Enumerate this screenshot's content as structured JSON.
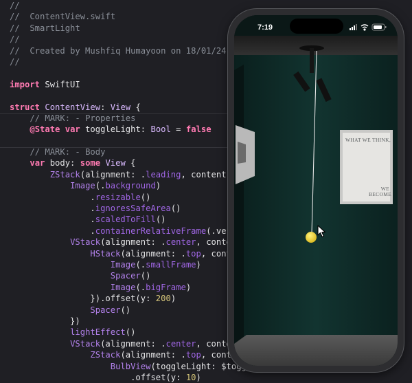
{
  "editor": {
    "lines": [
      [
        [
          "cm",
          "//"
        ]
      ],
      [
        [
          "cm",
          "//  ContentView.swift"
        ]
      ],
      [
        [
          "cm",
          "//  SmartLight"
        ]
      ],
      [
        [
          "cm",
          "//"
        ]
      ],
      [
        [
          "cm",
          "//  Created by Mushfiq Humayoon on 18/01/24."
        ]
      ],
      [
        [
          "cm",
          "//"
        ]
      ],
      [],
      [
        [
          "kw",
          "import"
        ],
        [
          "id",
          " SwiftUI"
        ]
      ],
      [],
      [
        [
          "kw",
          "struct"
        ],
        [
          "id",
          " "
        ],
        [
          "ty",
          "ContentView"
        ],
        [
          "id",
          ": "
        ],
        [
          "ty",
          "View"
        ],
        [
          "id",
          " {"
        ]
      ],
      [
        [
          "id",
          "    "
        ],
        [
          "cm",
          "// MARK: - Properties"
        ]
      ],
      [
        [
          "id",
          "    "
        ],
        [
          "kw",
          "@State"
        ],
        [
          "id",
          " "
        ],
        [
          "kw",
          "var"
        ],
        [
          "id",
          " toggleLight: "
        ],
        [
          "ty",
          "Bool"
        ],
        [
          "id",
          " = "
        ],
        [
          "kw",
          "false"
        ]
      ],
      [],
      [
        [
          "id",
          "    "
        ],
        [
          "cm",
          "// MARK: - Body"
        ]
      ],
      [
        [
          "id",
          "    "
        ],
        [
          "kw",
          "var"
        ],
        [
          "id",
          " body: "
        ],
        [
          "kw",
          "some"
        ],
        [
          "id",
          " "
        ],
        [
          "ty",
          "View"
        ],
        [
          "id",
          " {"
        ]
      ],
      [
        [
          "id",
          "        "
        ],
        [
          "fn",
          "ZStack"
        ],
        [
          "id",
          "(alignment: ."
        ],
        [
          "pr",
          "leading"
        ],
        [
          "id",
          ", content:"
        ]
      ],
      [
        [
          "id",
          "            "
        ],
        [
          "fn",
          "Image"
        ],
        [
          "id",
          "(."
        ],
        [
          "pr",
          "background"
        ],
        [
          "id",
          ")"
        ]
      ],
      [
        [
          "id",
          "                ."
        ],
        [
          "pr",
          "resizable"
        ],
        [
          "id",
          "()"
        ]
      ],
      [
        [
          "id",
          "                ."
        ],
        [
          "pr",
          "ignoresSafeArea"
        ],
        [
          "id",
          "()"
        ]
      ],
      [
        [
          "id",
          "                ."
        ],
        [
          "pr",
          "scaledToFill"
        ],
        [
          "id",
          "()"
        ]
      ],
      [
        [
          "id",
          "                ."
        ],
        [
          "pr",
          "containerRelativeFrame"
        ],
        [
          "id",
          "(.vert"
        ]
      ],
      [
        [
          "id",
          "            "
        ],
        [
          "fn",
          "VStack"
        ],
        [
          "id",
          "(alignment: ."
        ],
        [
          "pr",
          "center"
        ],
        [
          "id",
          ", conten"
        ]
      ],
      [
        [
          "id",
          "                "
        ],
        [
          "fn",
          "HStack"
        ],
        [
          "id",
          "(alignment: ."
        ],
        [
          "pr",
          "top"
        ],
        [
          "id",
          ", conte"
        ]
      ],
      [
        [
          "id",
          "                    "
        ],
        [
          "fn",
          "Image"
        ],
        [
          "id",
          "(."
        ],
        [
          "pr",
          "smallFrame"
        ],
        [
          "id",
          ")"
        ]
      ],
      [
        [
          "id",
          "                    "
        ],
        [
          "fn",
          "Spacer"
        ],
        [
          "id",
          "()"
        ]
      ],
      [
        [
          "id",
          "                    "
        ],
        [
          "fn",
          "Image"
        ],
        [
          "id",
          "(."
        ],
        [
          "pr",
          "bigFrame"
        ],
        [
          "id",
          ")"
        ]
      ],
      [
        [
          "id",
          "                }).offset(y: "
        ],
        [
          "nb",
          "200"
        ],
        [
          "id",
          ")"
        ]
      ],
      [
        [
          "id",
          "                "
        ],
        [
          "fn",
          "Spacer"
        ],
        [
          "id",
          "()"
        ]
      ],
      [
        [
          "id",
          "            })"
        ]
      ],
      [
        [
          "id",
          "            "
        ],
        [
          "fn",
          "lightEffect"
        ],
        [
          "id",
          "()"
        ]
      ],
      [
        [
          "id",
          "            "
        ],
        [
          "fn",
          "VStack"
        ],
        [
          "id",
          "(alignment: ."
        ],
        [
          "pr",
          "center"
        ],
        [
          "id",
          ", conten"
        ]
      ],
      [
        [
          "id",
          "                "
        ],
        [
          "fn",
          "ZStack"
        ],
        [
          "id",
          "(alignment: ."
        ],
        [
          "pr",
          "top"
        ],
        [
          "id",
          ", conte"
        ]
      ],
      [
        [
          "id",
          "                    "
        ],
        [
          "fn",
          "BulbView"
        ],
        [
          "id",
          "(toggleLight: $toggleLigh"
        ]
      ],
      [
        [
          "id",
          "                        .offset(y: "
        ],
        [
          "nb",
          "10"
        ],
        [
          "id",
          ")"
        ]
      ]
    ]
  },
  "simulator": {
    "time": "7:19",
    "frame_text_top": "WHAT WE THINK,",
    "frame_text_bottom": "WE BECOME",
    "bulb_color": "#f2d630",
    "wall_color": "#10302c",
    "floor_color": "#4a4a4a"
  }
}
